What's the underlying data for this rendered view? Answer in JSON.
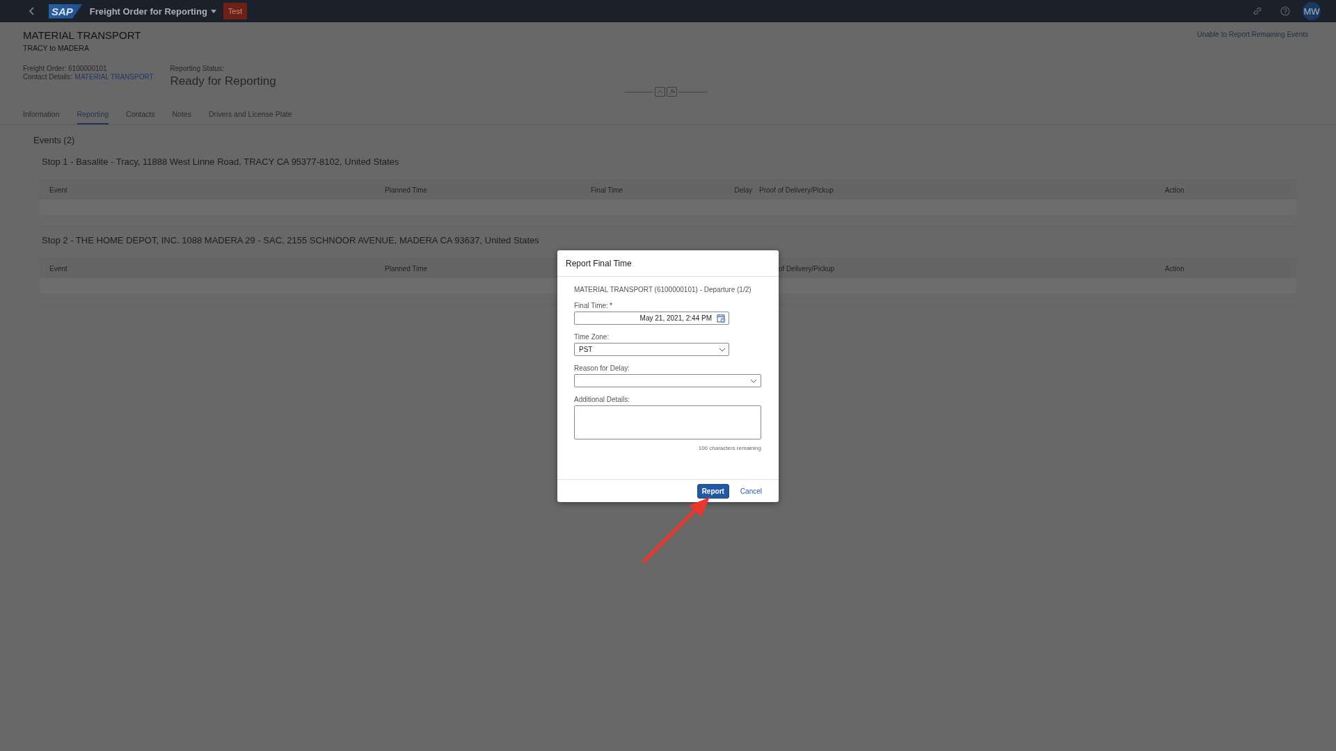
{
  "shell": {
    "logo": "SAP",
    "title": "Freight Order for Reporting",
    "badge": "Test",
    "avatar": "MW"
  },
  "header": {
    "title": "MATERIAL TRANSPORT",
    "subtitle": "TRACY to MADERA",
    "action_link": "Unable to Report Remaining Events",
    "freight_order": "Freight Order: 6100000101",
    "contact_label": "Contact Details:",
    "contact_link": "MATERIAL TRANSPORT",
    "status_label": "Reporting Status:",
    "status": "Ready for Reporting"
  },
  "tabs": [
    {
      "label": "Information",
      "selected": false
    },
    {
      "label": "Reporting",
      "selected": true
    },
    {
      "label": "Contacts",
      "selected": false
    },
    {
      "label": "Notes",
      "selected": false
    },
    {
      "label": "Drivers and License Plate",
      "selected": false
    }
  ],
  "events_title": "Events (2)",
  "stops": [
    {
      "title": "Stop 1 - Basalite - Tracy, 11888 West Linne Road, TRACY CA 95377-8102, United States",
      "columns": [
        {
          "kind": "event",
          "label": "Event"
        },
        {
          "kind": "planned",
          "label": "Planned Time"
        },
        {
          "kind": "final",
          "label": "Final Time"
        },
        {
          "kind": "delay",
          "label": "Delay"
        },
        {
          "kind": "proof",
          "label": "Proof of Delivery/Pickup"
        },
        {
          "kind": "action",
          "label": "Action"
        }
      ]
    },
    {
      "title": "Stop 2 - THE HOME DEPOT, INC. 1088 MADERA 29 - SAC, 2155 SCHNOOR AVENUE, MADERA CA 93637, United States",
      "columns": [
        {
          "kind": "event",
          "label": "Event"
        },
        {
          "kind": "planned",
          "label": "Planned Time"
        },
        {
          "kind": "cut",
          "label": "of Delivery/Pickup"
        },
        {
          "kind": "action",
          "label": "Action"
        }
      ]
    }
  ],
  "dialog": {
    "title": "Report Final Time",
    "subtitle": "MATERIAL TRANSPORT (6100000101) - Departure (1/2)",
    "fields": [
      {
        "kind": "date",
        "label": "Final Time:",
        "required_mark": "*",
        "value": "May 21, 2021, 2:44 PM"
      },
      {
        "kind": "select",
        "label": "Time Zone:",
        "value": "PST"
      },
      {
        "kind": "combo",
        "label": "Reason for Delay:"
      },
      {
        "kind": "textarea",
        "label": "Additional Details:"
      }
    ],
    "counter": "100 characters remaining",
    "buttons": [
      {
        "kind": "primary",
        "label": "Report"
      },
      {
        "kind": "link",
        "label": "Cancel"
      }
    ]
  }
}
